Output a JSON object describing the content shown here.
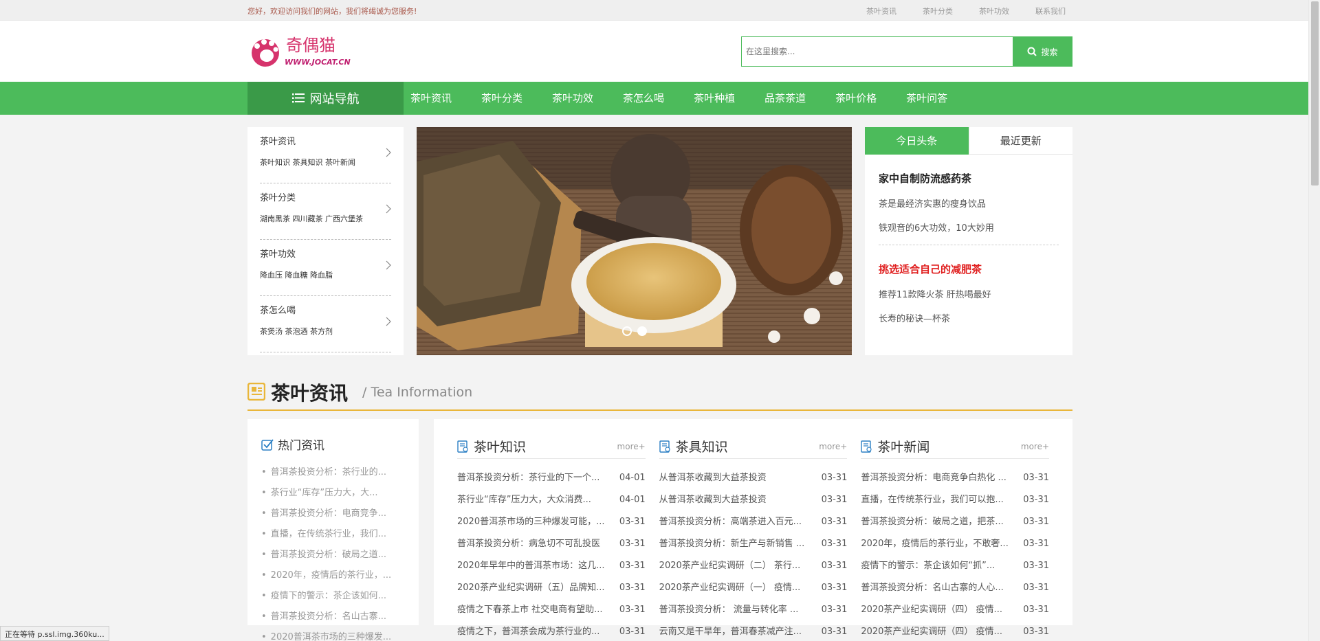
{
  "topbar": {
    "greeting": "您好，欢迎访问我们的网站，我们将竭诚为您服务!",
    "links": [
      "茶叶资讯",
      "茶叶分类",
      "茶叶功效",
      "联系我们"
    ]
  },
  "header": {
    "logo_text": "奇偶猫",
    "logo_url_text": "WWW.JOCAT.CN",
    "search_placeholder": "在这里搜索...",
    "search_button": "搜索"
  },
  "nav": {
    "all_label": "网站导航",
    "items": [
      "茶叶资讯",
      "茶叶分类",
      "茶叶功效",
      "茶怎么喝",
      "茶叶种植",
      "品茶茶道",
      "茶叶价格",
      "茶叶问答"
    ]
  },
  "categories": [
    {
      "title": "茶叶资讯",
      "subs": "茶叶知识 茶具知识 茶叶新闻"
    },
    {
      "title": "茶叶分类",
      "subs": "湖南黑茶 四川藏茶 广西六堡茶"
    },
    {
      "title": "茶叶功效",
      "subs": "降血压 降血糖 降血脂"
    },
    {
      "title": "茶怎么喝",
      "subs": "茶煲汤 茶泡酒 茶方剂"
    }
  ],
  "slider": {
    "active_index": 1,
    "count": 2
  },
  "news": {
    "tabs": [
      "今日头条",
      "最近更新"
    ],
    "headline1": "家中自制防流感药茶",
    "items1": [
      "茶是最经济实惠的瘦身饮品",
      "铁观音的6大功效，10大妙用"
    ],
    "headline2": "挑选适合自己的减肥茶",
    "items2": [
      "推荐11款降火茶 肝热喝最好",
      "长寿的秘诀—杯茶"
    ]
  },
  "section": {
    "title_cn": "茶叶资讯",
    "title_en": "/ Tea Information"
  },
  "hot": {
    "title": "热门资讯",
    "items": [
      "普洱茶投资分析：茶行业的...",
      "茶行业“库存”压力大，大...",
      "普洱茶投资分析：电商竞争...",
      "直播，在传统茶行业，我们...",
      "普洱茶投资分析：破局之道...",
      "2020年，疫情后的茶行业，...",
      "疫情下的警示：茶企该如何...",
      "普洱茶投资分析：名山古寨...",
      "2020普洱茶市场的三种爆发..."
    ]
  },
  "columns": [
    {
      "title": "茶叶知识",
      "more": "more+",
      "items": [
        {
          "t": "普洱茶投资分析：茶行业的下一个...",
          "d": "04-01"
        },
        {
          "t": "茶行业“库存”压力大，大众消费...",
          "d": "04-01"
        },
        {
          "t": "2020普洱茶市场的三种爆发可能，...",
          "d": "03-31"
        },
        {
          "t": "普洱茶投资分析：病急切不可乱投医",
          "d": "03-31"
        },
        {
          "t": "2020年早年中的普洱茶市场：这几...",
          "d": "03-31"
        },
        {
          "t": "2020茶产业纪实调研（五）品牌知...",
          "d": "03-31"
        },
        {
          "t": "疫情之下春茶上市 社交电商有望助...",
          "d": "03-31"
        },
        {
          "t": "疫情之下，普洱茶会成为茶行业的...",
          "d": "03-31"
        }
      ]
    },
    {
      "title": "茶具知识",
      "more": "more+",
      "items": [
        {
          "t": "从普洱茶收藏到大益茶投资",
          "d": "03-31"
        },
        {
          "t": "从普洱茶收藏到大益茶投资",
          "d": "03-31"
        },
        {
          "t": "普洱茶投资分析：高端茶进入百元...",
          "d": "03-31"
        },
        {
          "t": "普洱茶投资分析：新生产与新销售 ...",
          "d": "03-31"
        },
        {
          "t": "2020茶产业纪实调研（二） 茶行...",
          "d": "03-31"
        },
        {
          "t": "2020茶产业纪实调研（一） 疫情...",
          "d": "03-31"
        },
        {
          "t": "普洱茶投资分析： 流量与转化率 ...",
          "d": "03-31"
        },
        {
          "t": "云南又是干旱年，普洱春茶减产注...",
          "d": "03-31"
        }
      ]
    },
    {
      "title": "茶叶新闻",
      "more": "more+",
      "items": [
        {
          "t": "普洱茶投资分析：电商竞争白热化 ...",
          "d": "03-31"
        },
        {
          "t": "直播，在传统茶行业，我们可以抱...",
          "d": "03-31"
        },
        {
          "t": "普洱茶投资分析：破局之道，把茶...",
          "d": "03-31"
        },
        {
          "t": "2020年，疫情后的茶行业，不敢奢...",
          "d": "03-31"
        },
        {
          "t": "疫情下的警示：茶企该如何“抓”...",
          "d": "03-31"
        },
        {
          "t": "普洱茶投资分析：名山古寨的人心...",
          "d": "03-31"
        },
        {
          "t": "2020茶产业纪实调研（四） 疫情...",
          "d": "03-31"
        },
        {
          "t": "2020茶产业纪实调研（四） 疫情...",
          "d": "03-31"
        }
      ]
    }
  ],
  "status_bar": "正在等待 p.ssl.img.360ku...",
  "colors": {
    "green": "#4cbb5b",
    "dark_green": "#3a9a48",
    "gold": "#e9b63a",
    "red": "#e02020"
  }
}
